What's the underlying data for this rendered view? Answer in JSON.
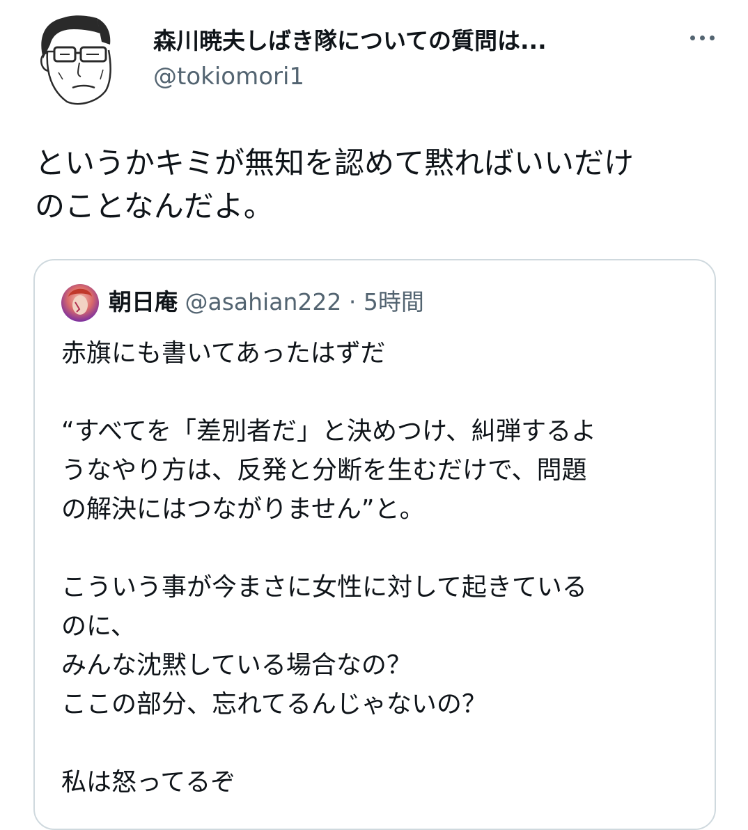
{
  "tweet": {
    "author_name": "森川暁夫しばき隊についての質問は...",
    "author_handle": "@tokiomori1",
    "more_icon": "more-horizontal-icon",
    "text_lines": [
      "というかキミが無知を認めて黙ればいいだけ",
      "のことなんだよ。"
    ]
  },
  "quoted_tweet": {
    "author_name": "朝日庵",
    "author_handle": "@asahian222",
    "separator": "·",
    "time": "5時間",
    "lines": [
      "赤旗にも書いてあったはずだ",
      "",
      "“すべてを「差別者だ」と決めつけ、糾弾するよ",
      "うなやり方は、反発と分断を生むだけで、問題",
      "の解決にはつながりません”と。",
      "",
      "こういう事が今まさに女性に対して起きている",
      "のに、",
      "みんな沈黙している場合なの？",
      "ここの部分、忘れてるんじゃないの？",
      "",
      "私は怒ってるぞ"
    ]
  },
  "colors": {
    "text_primary": "#0f1419",
    "text_secondary": "#536471",
    "border": "#cfd9de"
  }
}
